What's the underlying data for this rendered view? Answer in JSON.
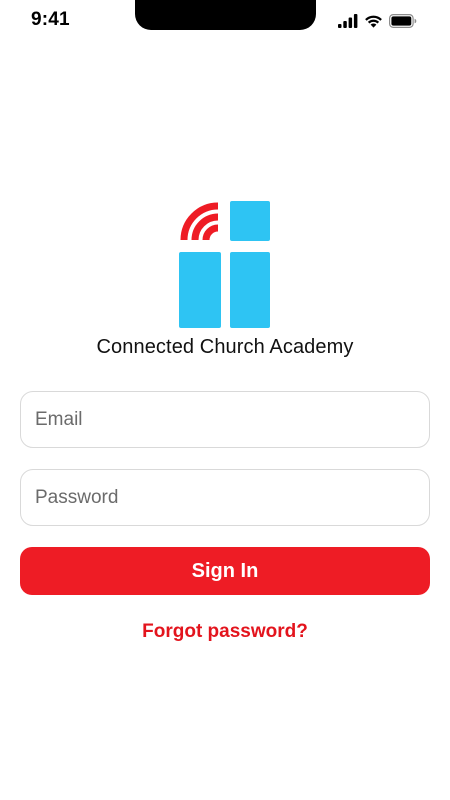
{
  "status_bar": {
    "time": "9:41",
    "icons": [
      "cellular-signal-icon",
      "wifi-icon",
      "battery-icon"
    ]
  },
  "brand": {
    "logo_icon": "connected-church-cross-icon",
    "name": "Connected Church Academy",
    "colors": {
      "logo_blue": "#2ec4f3",
      "accent_red": "#ee1c25"
    }
  },
  "login_form": {
    "email": {
      "placeholder": "Email",
      "value": ""
    },
    "password": {
      "placeholder": "Password",
      "value": ""
    },
    "signin_label": "Sign In",
    "forgot_password_label": "Forgot password?"
  }
}
